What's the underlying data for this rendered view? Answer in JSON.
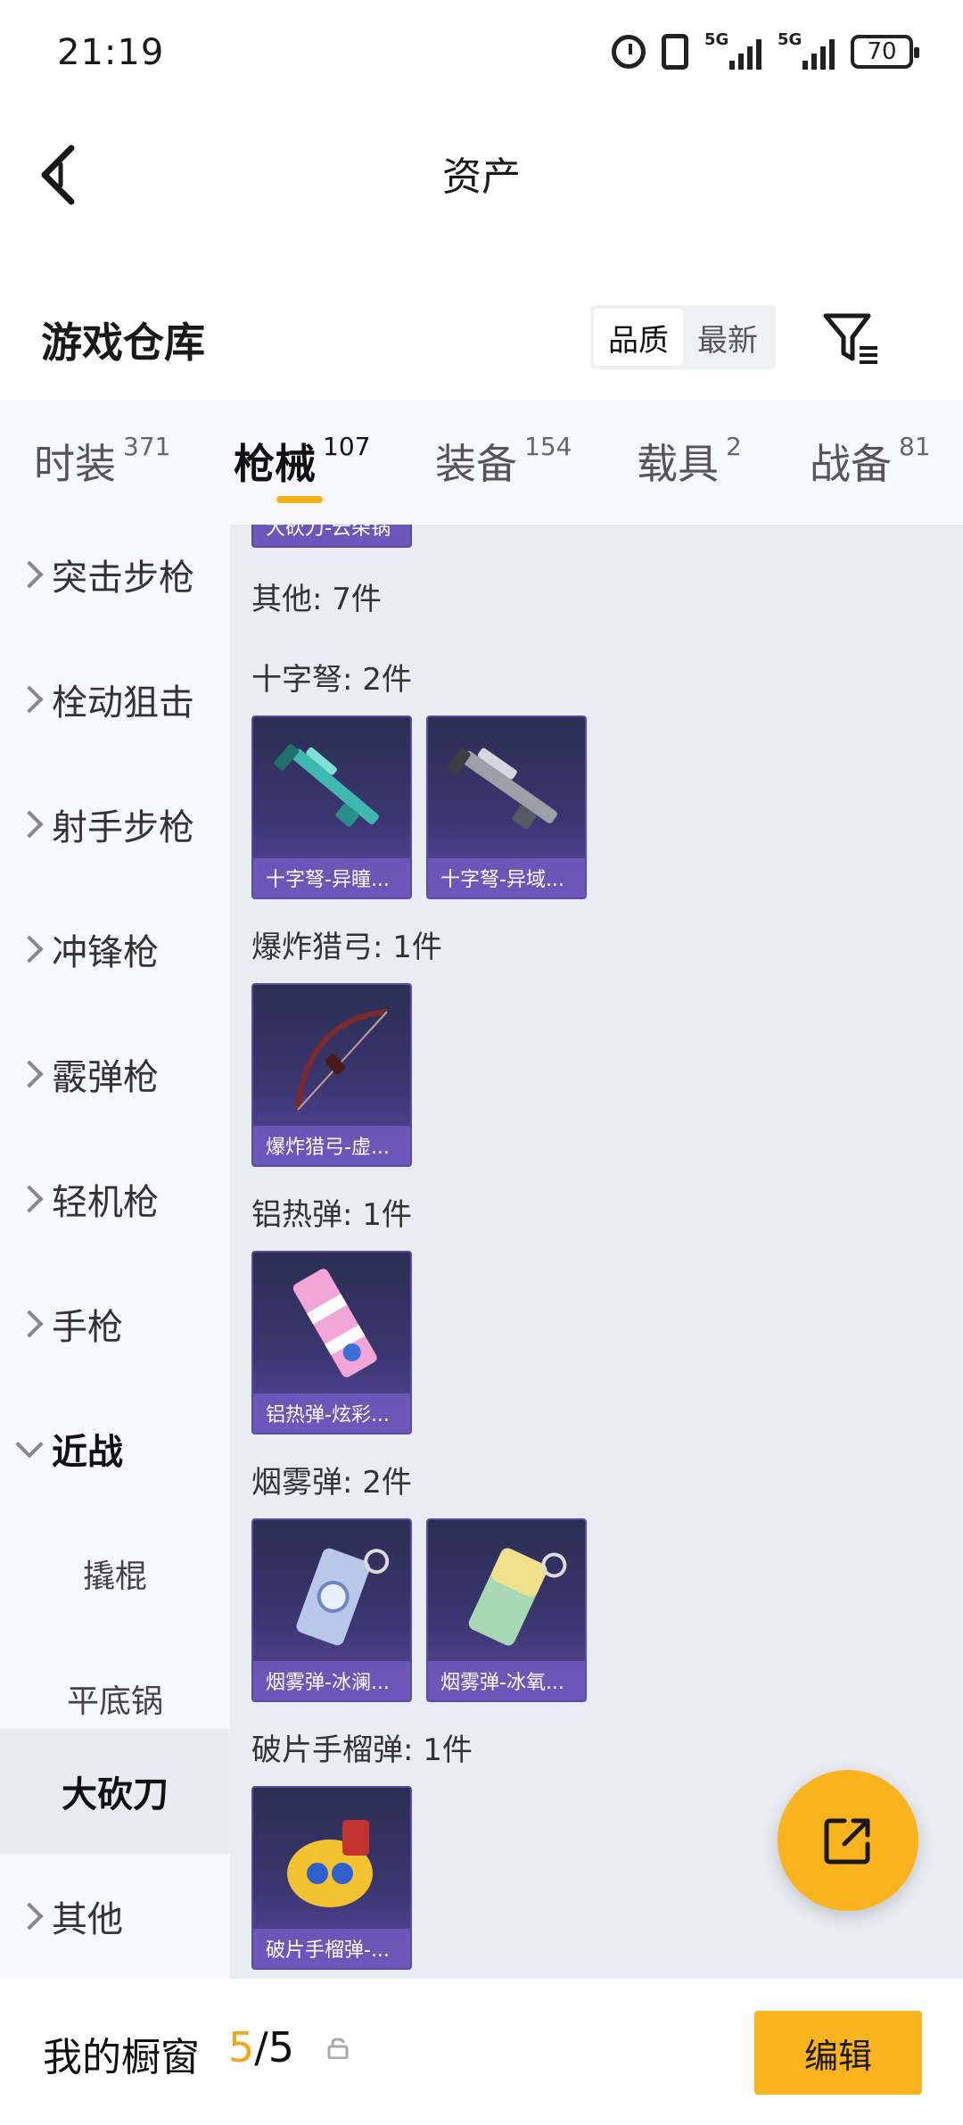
{
  "status_bar": {
    "time": "21:19",
    "network1": "5G",
    "network2": "5G",
    "battery": "70"
  },
  "header": {
    "title": "资产"
  },
  "warehouse": {
    "title": "游戏仓库",
    "sort_options": [
      "品质",
      "最新"
    ],
    "active_sort": "品质"
  },
  "tabs": [
    {
      "label": "时装",
      "count": "371"
    },
    {
      "label": "枪械",
      "count": "107"
    },
    {
      "label": "装备",
      "count": "154"
    },
    {
      "label": "载具",
      "count": "2"
    },
    {
      "label": "战备",
      "count": "81"
    }
  ],
  "active_tab": "枪械",
  "sidebar": {
    "items": [
      {
        "label": "突击步枪"
      },
      {
        "label": "栓动狙击"
      },
      {
        "label": "射手步枪"
      },
      {
        "label": "冲锋枪"
      },
      {
        "label": "霰弹枪"
      },
      {
        "label": "轻机枪"
      },
      {
        "label": "手枪"
      },
      {
        "label": "近战"
      }
    ],
    "sub_items": [
      {
        "label": "撬棍"
      },
      {
        "label": "平底锅"
      },
      {
        "label": "大砍刀"
      }
    ],
    "last_item": {
      "label": "其他"
    }
  },
  "content": {
    "partial_top_card": "大砍刀-云朵锅",
    "other_label": "其他: 7件",
    "sections": [
      {
        "label": "十字弩: 2件",
        "items": [
          "十字弩-异瞳...",
          "十字弩-异域..."
        ]
      },
      {
        "label": "爆炸猎弓: 1件",
        "items": [
          "爆炸猎弓-虚..."
        ]
      },
      {
        "label": "铝热弹: 1件",
        "items": [
          "铝热弹-炫彩..."
        ]
      },
      {
        "label": "烟雾弹: 2件",
        "items": [
          "烟雾弹-冰澜...",
          "烟雾弹-冰氧..."
        ]
      },
      {
        "label": "破片手榴弹: 1件",
        "items": [
          "破片手榴弹-..."
        ]
      }
    ]
  },
  "bottom": {
    "showcase_label": "我的橱窗",
    "showcase_current": "5",
    "showcase_sep": "/",
    "showcase_total": "5",
    "edit_label": "编辑"
  },
  "colors": {
    "accent": "#f8b31d",
    "card_bg": "#3b3570"
  }
}
